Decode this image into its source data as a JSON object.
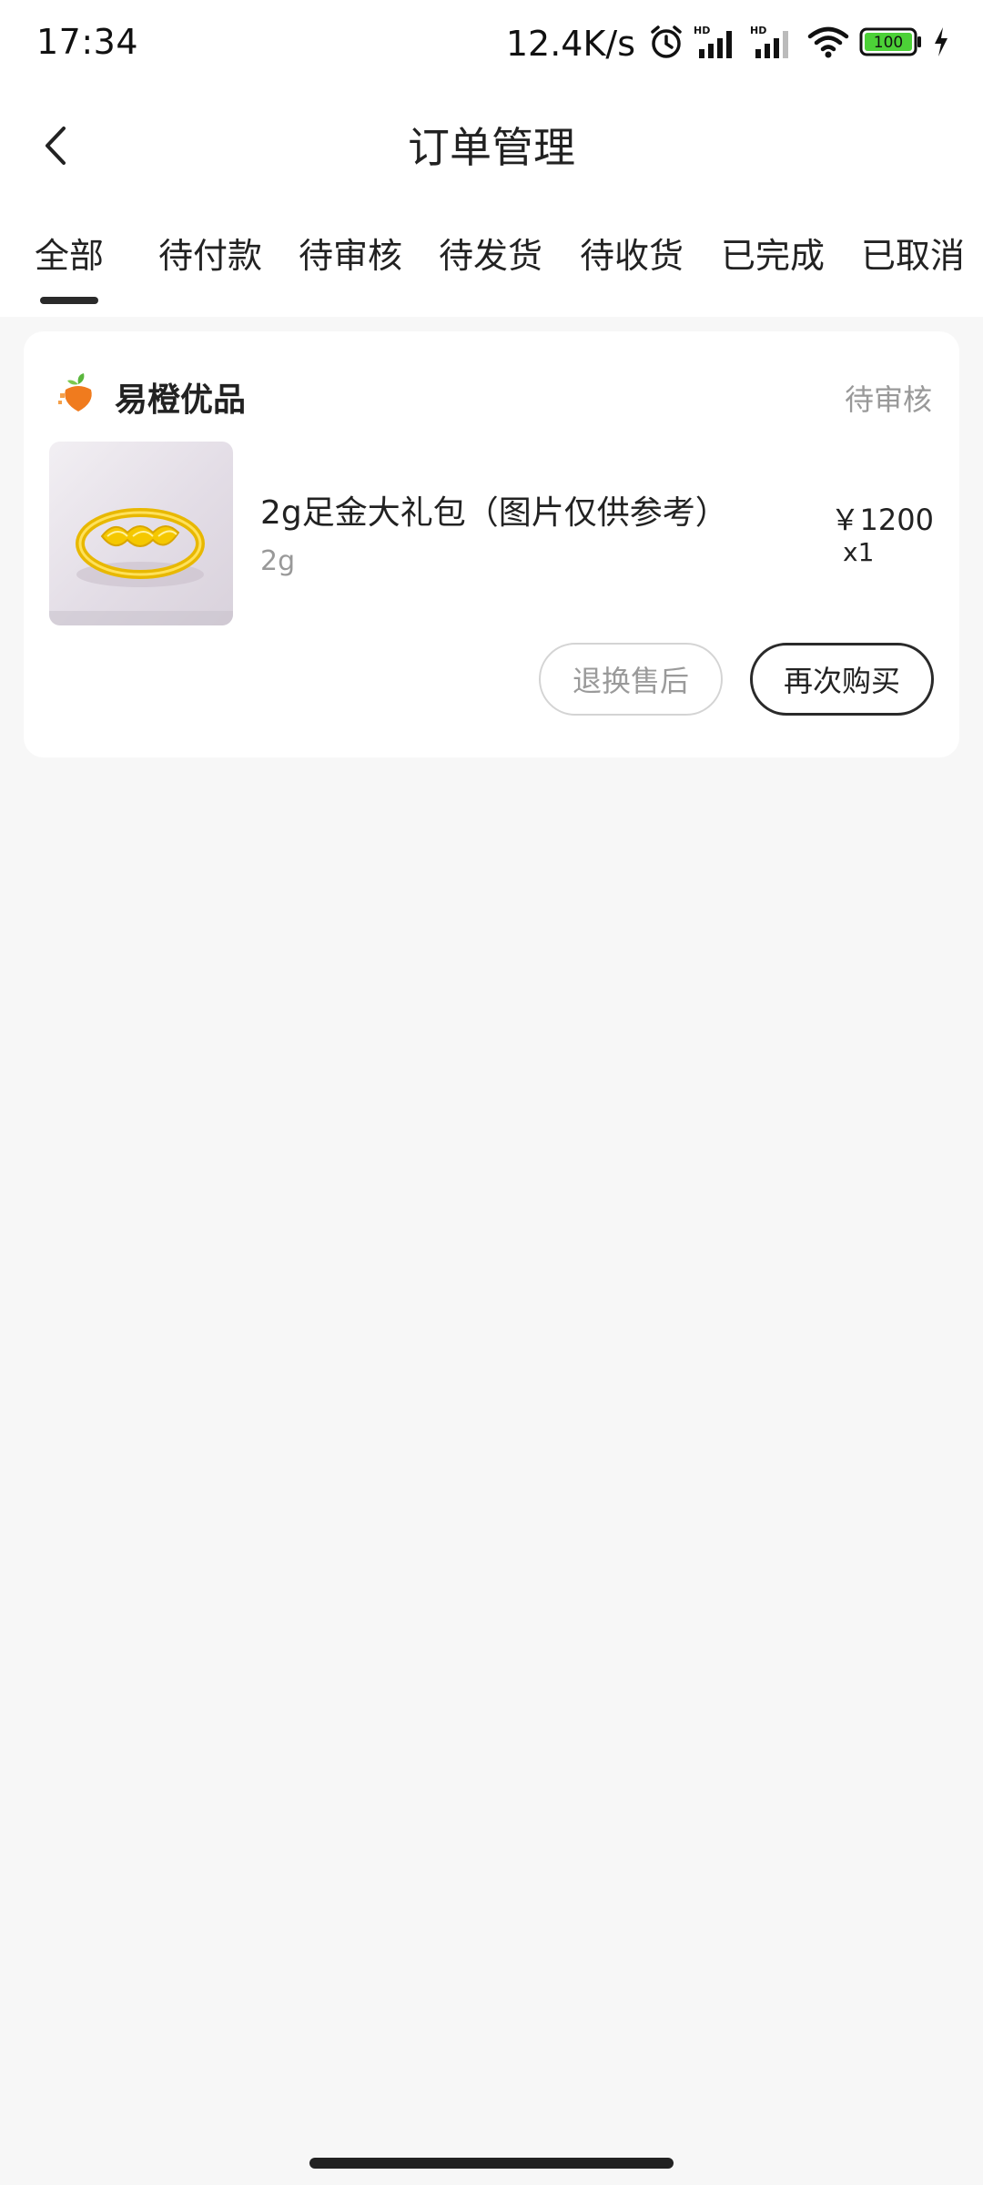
{
  "status_bar": {
    "time": "17:34",
    "net_speed": "12.4K/s",
    "battery": "100",
    "icons": [
      "alarm-icon",
      "signal-hd-icon",
      "signal-hd-icon",
      "wifi-icon",
      "battery-icon",
      "charging-icon"
    ]
  },
  "nav": {
    "back_icon": "chevron-left-icon",
    "title": "订单管理"
  },
  "tabs": [
    {
      "label": "全部",
      "active": true
    },
    {
      "label": "待付款",
      "active": false
    },
    {
      "label": "待审核",
      "active": false
    },
    {
      "label": "待发货",
      "active": false
    },
    {
      "label": "待收货",
      "active": false
    },
    {
      "label": "已完成",
      "active": false
    },
    {
      "label": "已取消",
      "active": false
    }
  ],
  "order": {
    "shop_name": "易橙优品",
    "shop_logo_icon": "orange-logo-icon",
    "status": "待审核",
    "product": {
      "name": "2g足金大礼包（图片仅供参考）",
      "spec": "2g",
      "price": "￥1200",
      "quantity": "x1",
      "image": "gold-ring-image"
    },
    "actions": {
      "after_sale": "退换售后",
      "rebuy": "再次购买"
    }
  },
  "colors": {
    "background": "#f7f7f7",
    "card": "#ffffff",
    "gold": "#f2c200",
    "brand_orange": "#f07b1e",
    "brand_green": "#5ab63c"
  }
}
